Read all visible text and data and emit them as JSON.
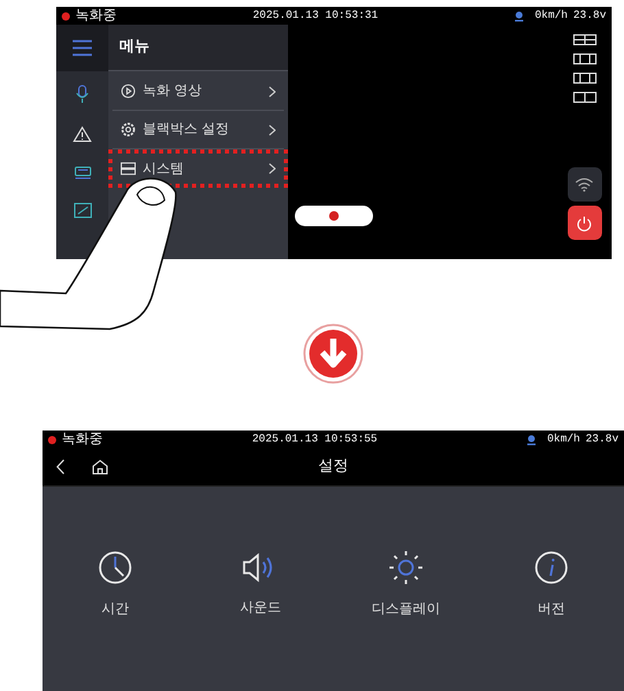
{
  "top_screen": {
    "status_bar": {
      "recording": true,
      "recording_label": "녹화중",
      "datetime": "2025.01.13 10:53:31",
      "speed": "0km/h",
      "voltage": "23.8v"
    },
    "menu": {
      "title": "메뉴",
      "items": [
        {
          "kind": "video",
          "label": "녹화 영상",
          "highlighted": false
        },
        {
          "kind": "settings",
          "label": "블랙박스 설정",
          "highlighted": false
        },
        {
          "kind": "system",
          "label": "시스템",
          "highlighted": true
        }
      ]
    }
  },
  "bottom_screen": {
    "status_bar": {
      "recording": true,
      "recording_label": "녹화중",
      "datetime": "2025.01.13 10:53:55",
      "speed": "0km/h",
      "voltage": "23.8v"
    },
    "title": "설정",
    "items": [
      {
        "kind": "time",
        "label": "시간"
      },
      {
        "kind": "sound",
        "label": "사운드"
      },
      {
        "kind": "display",
        "label": "디스플레이"
      },
      {
        "kind": "version",
        "label": "버전"
      }
    ]
  }
}
